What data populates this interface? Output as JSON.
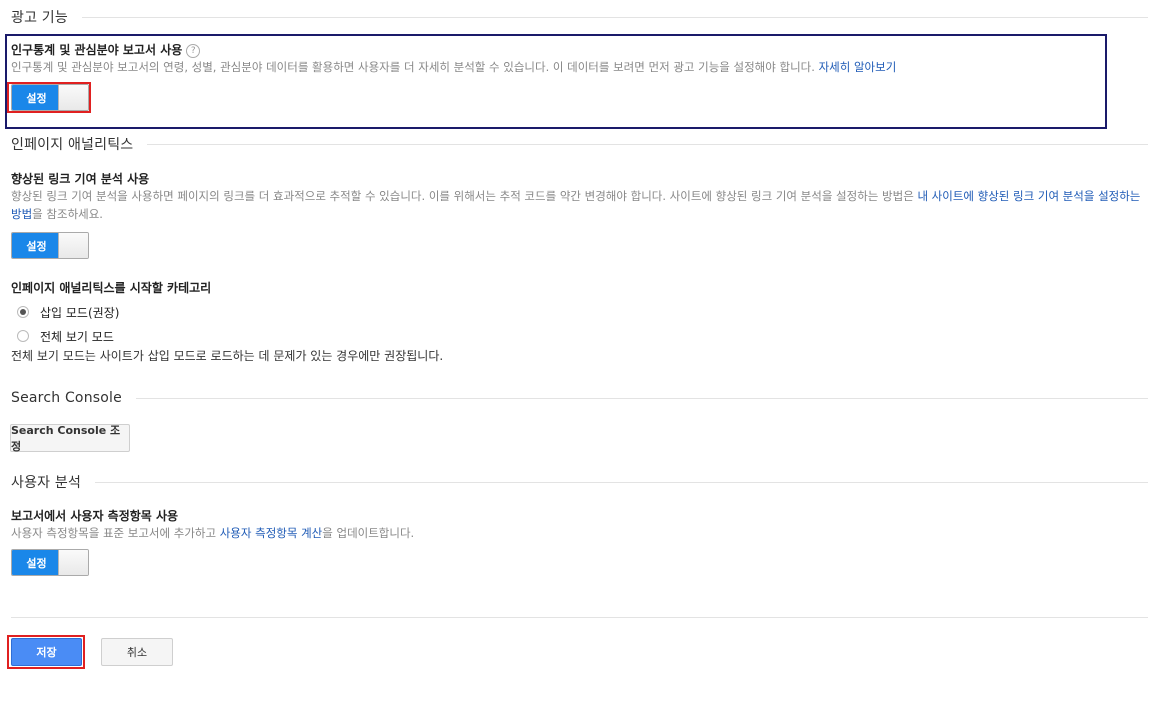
{
  "sections": {
    "ads": {
      "title": "광고 기능",
      "demographics": {
        "title": "인구통계 및 관심분야 보고서 사용",
        "help_icon": "?",
        "description": "인구통계 및 관심분야 보고서의 연령, 성별, 관심분야 데이터를 활용하면 사용자를 더 자세히 분석할 수 있습니다. 이 데이터를 보려면 먼저 광고 기능을 설정해야 합니다.",
        "learn_more": "자세히 알아보기",
        "toggle_label": "설정"
      }
    },
    "inpage": {
      "title": "인페이지 애널리틱스",
      "enhanced_link": {
        "title": "향상된 링크 기여 분석 사용",
        "description": "향상된 링크 기여 분석을 사용하면 페이지의 링크를 더 효과적으로 추적할 수 있습니다. 이를 위해서는 추적 코드를 약간 변경해야 합니다. 사이트에 향상된 링크 기여 분석을 설정하는 방법은",
        "link": "내 사이트에 향상된 링크 기여 분석을 설정하는 방법",
        "suffix": "을 참조하세요.",
        "toggle_label": "설정"
      },
      "start_category": {
        "title": "인페이지 애널리틱스를 시작할 카테고리",
        "options": [
          "삽입 모드(권장)",
          "전체 보기 모드"
        ],
        "selected_index": 0,
        "note": "전체 보기 모드는 사이트가 삽입 모드로 로드하는 데 문제가 있는 경우에만 권장됩니다."
      }
    },
    "search_console": {
      "title": "Search Console",
      "button_label": "Search Console 조정"
    },
    "user_analysis": {
      "title": "사용자 분석",
      "custom_metrics": {
        "title": "보고서에서 사용자 측정항목 사용",
        "desc_prefix": "사용자 측정항목을 표준 보고서에 추가하고",
        "link": "사용자 측정항목 계산",
        "desc_suffix": "을 업데이트합니다.",
        "toggle_label": "설정"
      }
    }
  },
  "footer": {
    "save_label": "저장",
    "cancel_label": "취소"
  },
  "colors": {
    "toggle_on": "#1a87e9",
    "link": "#1f5bb6",
    "save_button": "#4a8cf5",
    "highlight_red": "#e02020",
    "highlight_navy": "#1a1a6a"
  },
  "icons": {
    "help": "help-icon"
  }
}
